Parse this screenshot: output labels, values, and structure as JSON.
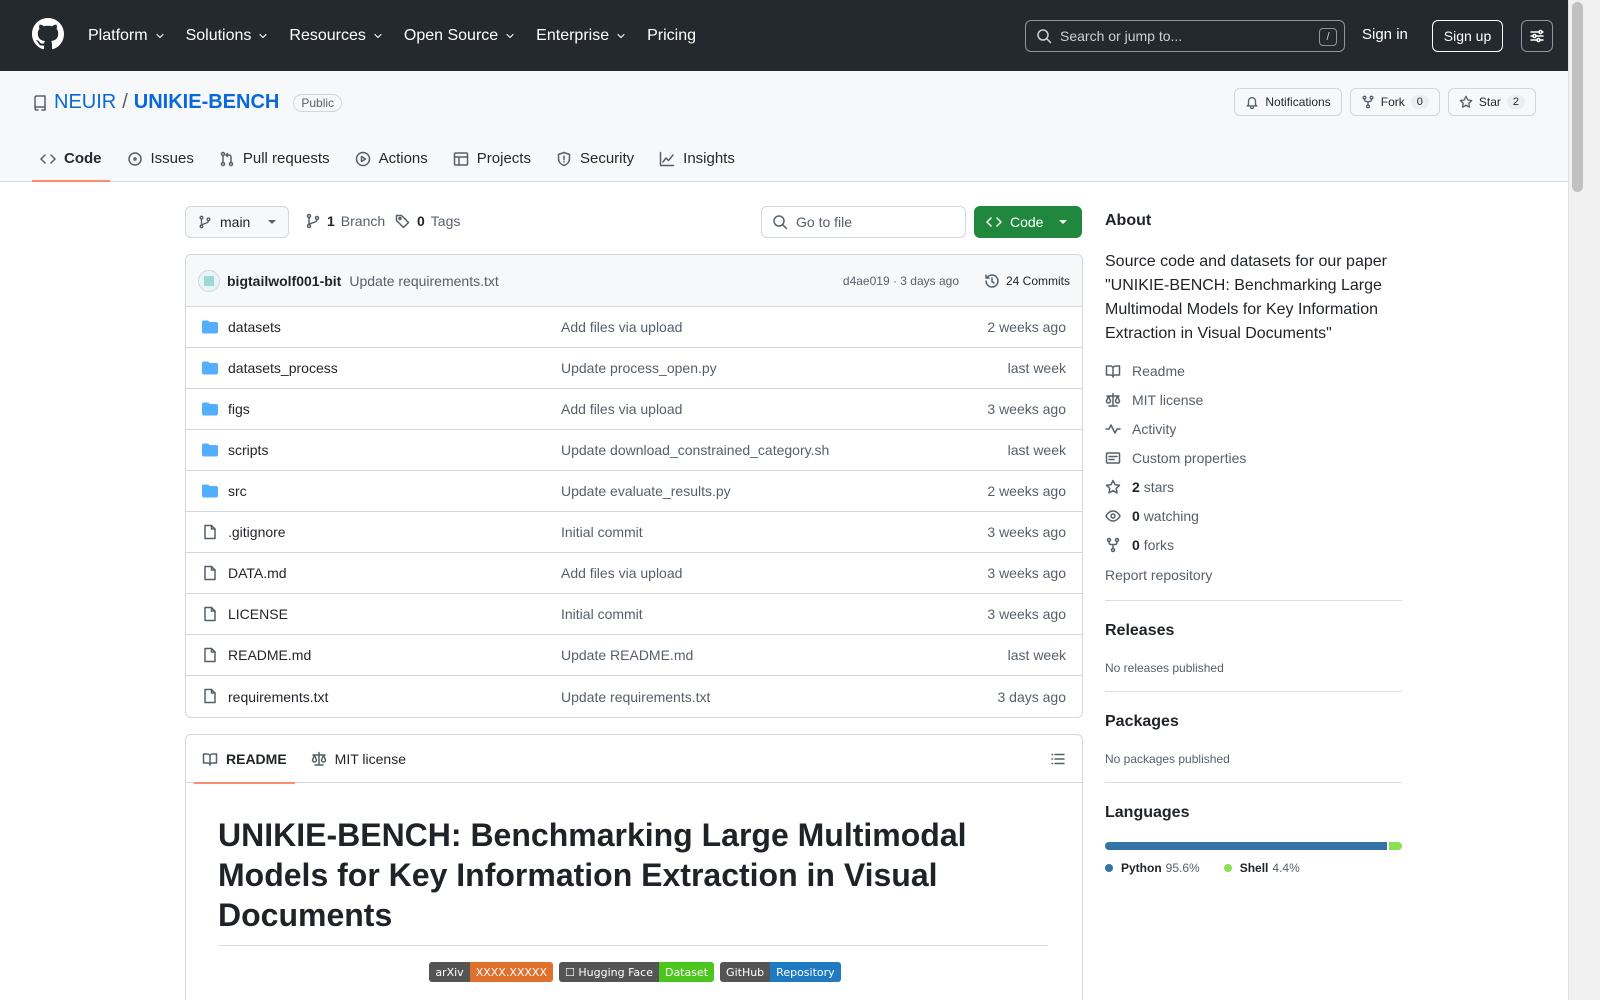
{
  "colors": {
    "header_bg": "#24292f",
    "accent": "#0969da",
    "green": "#1f883d",
    "python": "#3572A5",
    "shell": "#89e051"
  },
  "header": {
    "nav": [
      "Platform",
      "Solutions",
      "Resources",
      "Open Source",
      "Enterprise",
      "Pricing"
    ],
    "search_placeholder": "Search or jump to...",
    "search_shortcut": "/",
    "sign_in": "Sign in",
    "sign_up": "Sign up"
  },
  "repo": {
    "owner": "NEUIR",
    "separator": "/",
    "name": "UNIKIE-BENCH",
    "visibility": "Public",
    "notifications_label": "Notifications",
    "fork_label": "Fork",
    "fork_count": "0",
    "star_label": "Star",
    "star_count": "2",
    "tabs": [
      "Code",
      "Issues",
      "Pull requests",
      "Actions",
      "Projects",
      "Security",
      "Insights"
    ]
  },
  "toolbar": {
    "branch": "main",
    "branch_count": "1",
    "branch_label": "Branch",
    "tag_count": "0",
    "tag_label": "Tags",
    "go_to_file": "Go to file",
    "code_button": "Code"
  },
  "latest_commit": {
    "author": "bigtailwolf001-bit",
    "message": "Update requirements.txt",
    "meta": "d4ae019 · 3 days ago",
    "commit_count": "24 Commits"
  },
  "files": [
    {
      "name": "datasets",
      "type": "dir",
      "commit": "Add files via upload",
      "date": "2 weeks ago"
    },
    {
      "name": "datasets_process",
      "type": "dir",
      "commit": "Update process_open.py",
      "date": "last week"
    },
    {
      "name": "figs",
      "type": "dir",
      "commit": "Add files via upload",
      "date": "3 weeks ago"
    },
    {
      "name": "scripts",
      "type": "dir",
      "commit": "Update download_constrained_category.sh",
      "date": "last week"
    },
    {
      "name": "src",
      "type": "dir",
      "commit": "Update evaluate_results.py",
      "date": "2 weeks ago"
    },
    {
      "name": ".gitignore",
      "type": "file",
      "commit": "Initial commit",
      "date": "3 weeks ago"
    },
    {
      "name": "DATA.md",
      "type": "file",
      "commit": "Add files via upload",
      "date": "3 weeks ago"
    },
    {
      "name": "LICENSE",
      "type": "file",
      "commit": "Initial commit",
      "date": "3 weeks ago"
    },
    {
      "name": "README.md",
      "type": "file",
      "commit": "Update README.md",
      "date": "last week"
    },
    {
      "name": "requirements.txt",
      "type": "file",
      "commit": "Update requirements.txt",
      "date": "3 days ago"
    }
  ],
  "readme": {
    "tab_readme": "README",
    "tab_license": "MIT license",
    "title": "UNIKIE-BENCH: Benchmarking Large Multimodal Models for Key Information Extraction in Visual Documents",
    "badges": [
      {
        "left": "arXiv",
        "right": "XXXX.XXXXX",
        "right_color": "#e0712c"
      },
      {
        "left": "☐ Hugging Face",
        "right": "Dataset",
        "right_color": "#4cc61e"
      },
      {
        "left": "GitHub",
        "right": "Repository",
        "right_color": "#1f7ac2"
      }
    ]
  },
  "about": {
    "heading": "About",
    "description": "Source code and datasets for our paper \"UNIKIE-BENCH: Benchmarking Large Multimodal Models for Key Information Extraction in Visual Documents\"",
    "readme": "Readme",
    "license": "MIT license",
    "activity": "Activity",
    "custom_properties": "Custom properties",
    "stars_count": "2",
    "stars_label": "stars",
    "watching_count": "0",
    "watching_label": "watching",
    "forks_count": "0",
    "forks_label": "forks",
    "report": "Report repository"
  },
  "releases": {
    "heading": "Releases",
    "note": "No releases published"
  },
  "packages": {
    "heading": "Packages",
    "note": "No packages published"
  },
  "languages": {
    "heading": "Languages",
    "items": [
      {
        "name": "Python",
        "percent": "95.6%",
        "value": 95.6,
        "color": "#3572A5"
      },
      {
        "name": "Shell",
        "percent": "4.4%",
        "value": 4.4,
        "color": "#89e051"
      }
    ]
  }
}
